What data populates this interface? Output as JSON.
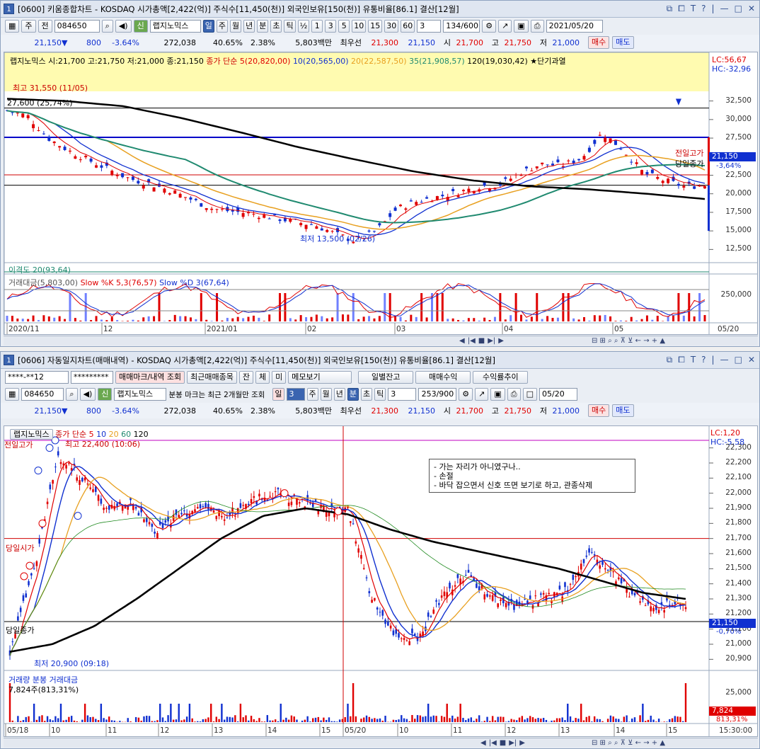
{
  "w1": {
    "num": "1",
    "title": "[0600] 키움종합차트 - KOSDAQ 시가총액[2,422(억)] 주식수[11,450(천)] 외국인보유[150(천)] 유통비율[86.1] 결산[12월]",
    "toolbar": {
      "period": "주",
      "jeon": "전",
      "code": "084650",
      "stock": "랩지노믹스",
      "shin": "신",
      "pbtns": [
        "일",
        "주",
        "월",
        "년",
        "분",
        "초",
        "틱"
      ],
      "nums": [
        "½",
        "1",
        "3",
        "5",
        "10",
        "15",
        "30",
        "60"
      ],
      "sel": "3",
      "count": "134/600",
      "date": "2021/05/20"
    },
    "price": {
      "cur": "21,150",
      "arrow": "▼",
      "chg": "800",
      "pct": "-3.64%",
      "vol": "272,038",
      "r1": "40.65%",
      "r2": "2.38%",
      "amt": "5,803백만",
      "best": "최우선",
      "b1": "21,300",
      "b2": "21,150",
      "o_l": "시",
      "o": "21,700",
      "h_l": "고",
      "h": "21,750",
      "l_l": "저",
      "l": "21,000",
      "buy": "매수",
      "sell": "매도"
    },
    "legend": {
      "name": "랩지노믹스",
      "ohlc": "시:21,700 고:21,750 저:21,000 종:21,150",
      "ma_t": "종가 단순",
      "ma5": "5(20,820,00)",
      "ma10": "10(20,565,00)",
      "ma20": "20(22,587,50)",
      "ma35": "35(21,908,57)",
      "ma120": "120(19,030,42)",
      "signal": "★단기과열"
    },
    "lc": "LC:56,67",
    "hc": "HC:-32,96",
    "yticks": [
      "32,500",
      "30,000",
      "27,500",
      "25,000",
      "22,500",
      "20,000",
      "17,500",
      "15,000",
      "12,500"
    ],
    "tag_cur": "21,150",
    "tag_pct": "-3,64%",
    "hi_lbl": "최고 31,550 (11/05)",
    "lo_lbl": "최저 13,500 (02/26)",
    "line_lbl": "27,600 (25,74%)",
    "prev_high": "전일고가",
    "today_close": "당일종가",
    "ind1": "이격도 20(93,64)",
    "ind2": {
      "a": "거래대금(5,803,00)",
      "b": "Slow %K 5,3(76,57)",
      "c": "Slow %D 3(67,64)",
      "tick": "250,000"
    },
    "xticks": [
      "2020/11",
      "12",
      "2021/01",
      "02",
      "03",
      "04",
      "05"
    ],
    "xright": "05/20"
  },
  "w2": {
    "num": "1",
    "title": "[0606] 자동일지차트(매매내역) - KOSDAQ 시가총액[2,422(억)] 주식수[11,450(천)] 외국인보유[150(천)] 유통비율[86.1] 결산[12월]",
    "acct": "****-**12",
    "pw": "*********",
    "b_mark": "매매마크/내역 조회",
    "b_list": "최근매매종목",
    "b_jan": "잔",
    "b_che": "체",
    "b_mi": "미",
    "b_memo": "메모보기",
    "b_daily": "일별잔고",
    "b_profit": "매매수익",
    "b_rate": "수익률추이",
    "code": "084650",
    "stock": "랩지노믹스",
    "shin": "신",
    "note": "분봉 마크는 최근 2개월만 조회",
    "ilbl": "일",
    "isel": "3",
    "pbtns": [
      "주",
      "월",
      "년",
      "분",
      "초",
      "틱"
    ],
    "tsel": "3",
    "count": "253/900",
    "date": "05/20",
    "price": {
      "cur": "21,150",
      "arrow": "▼",
      "chg": "800",
      "pct": "-3.64%",
      "vol": "272,038",
      "r1": "40.65%",
      "r2": "2.38%",
      "amt": "5,803백만",
      "best": "최우선",
      "b1": "21,300",
      "b2": "21,150",
      "o_l": "시",
      "o": "21,700",
      "h_l": "고",
      "h": "21,750",
      "l_l": "저",
      "l": "21,000",
      "buy": "매수",
      "sell": "매도"
    },
    "legend": {
      "name": "랩지노믹스",
      "ma_t": "종가 단순",
      "m5": "5",
      "m10": "10",
      "m20": "20",
      "m60": "60",
      "m120": "120"
    },
    "lc": "LC:1,20",
    "hc": "HC:-5,58",
    "yticks": [
      "22,300",
      "22,200",
      "22,100",
      "22,000",
      "21,900",
      "21,800",
      "21,700",
      "21,600",
      "21,500",
      "21,400",
      "21,300",
      "21,200",
      "21,100",
      "21,000",
      "20,900"
    ],
    "tag_cur": "21,150",
    "tag_pct": "-0,70%",
    "prev_high": "전일고가",
    "today_open": "당일시가",
    "today_close": "당일종가",
    "hi_lbl": "최고 22,400 (10:06)",
    "lo_lbl": "최저 20,900 (09:18)",
    "memo": [
      "- 가는 자리가 아니였구나..",
      "- 손절",
      "- 바닥 잡으면서 신호 뜨면 보기로 하고, 관종삭제"
    ],
    "vol_a": "거래량",
    "vol_b": "분봉 거래대금",
    "vol_c": "7,824주(813,31%)",
    "vtick": "25,000",
    "vtag": "7,824",
    "vtag2": "813,31%",
    "xticks": [
      "05/18",
      "10",
      "11",
      "12",
      "13",
      "14",
      "15",
      "05/20",
      "10",
      "11",
      "12",
      "13",
      "14",
      "15"
    ],
    "time": "15:30:00"
  },
  "colors": {
    "up": "#e00000",
    "down": "#1030d0",
    "ma5": "#e00000",
    "ma10": "#1030d0",
    "ma20": "#e8a020",
    "ma35": "#208a70",
    "ma120": "#000000"
  }
}
